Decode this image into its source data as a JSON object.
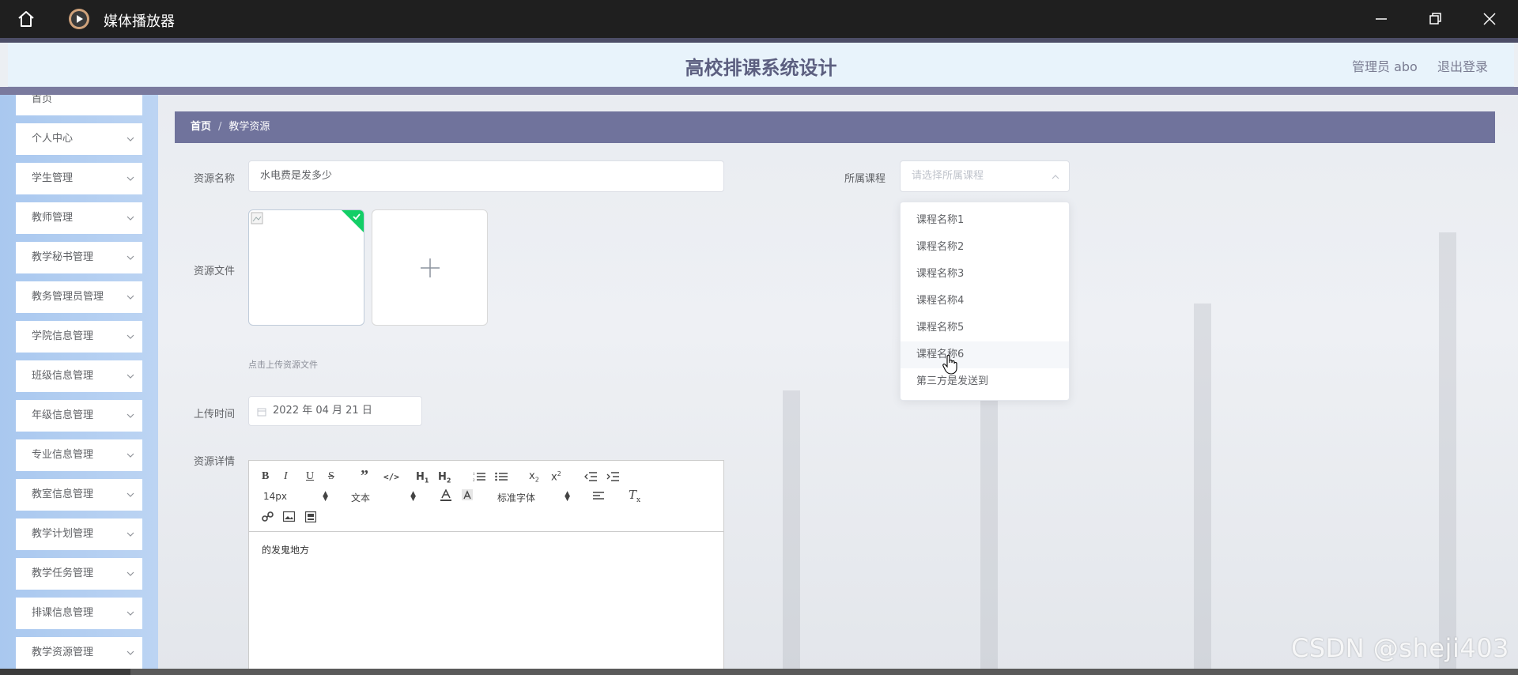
{
  "window": {
    "title": "媒体播放器"
  },
  "header": {
    "title": "高校排课系统设计",
    "user": "管理员 abo",
    "logout": "退出登录"
  },
  "sidebar": {
    "items": [
      {
        "label": "首页"
      },
      {
        "label": "个人中心"
      },
      {
        "label": "学生管理"
      },
      {
        "label": "教师管理"
      },
      {
        "label": "教学秘书管理"
      },
      {
        "label": "教务管理员管理"
      },
      {
        "label": "学院信息管理"
      },
      {
        "label": "班级信息管理"
      },
      {
        "label": "年级信息管理"
      },
      {
        "label": "专业信息管理"
      },
      {
        "label": "教室信息管理"
      },
      {
        "label": "教学计划管理"
      },
      {
        "label": "教学任务管理"
      },
      {
        "label": "排课信息管理"
      },
      {
        "label": "教学资源管理"
      }
    ]
  },
  "breadcrumb": {
    "home": "首页",
    "separator": "/",
    "current": "教学资源"
  },
  "form": {
    "name_label": "资源名称",
    "name_value": "水电费是发多少",
    "course_label": "所属课程",
    "course_placeholder": "请选择所属课程",
    "file_label": "资源文件",
    "upload_hint": "点击上传资源文件",
    "time_label": "上传时间",
    "time_value": "2022 年 04 月 21 日",
    "detail_label": "资源详情"
  },
  "editor": {
    "size_select": "14px",
    "text_select": "文本",
    "font_select": "标准字体",
    "content": "的发鬼地方"
  },
  "course_dropdown": {
    "hovered_index": 5,
    "options": [
      "课程名称1",
      "课程名称2",
      "课程名称3",
      "课程名称4",
      "课程名称5",
      "课程名称6",
      "第三方是发送到"
    ]
  },
  "watermark": "CSDN @sheji403",
  "colors": {
    "titlebar": "#1f1f1f",
    "breadcrumb": "#70739c",
    "header_bg": "#e8f3fb",
    "header_text": "#5c5f80",
    "sidebar_bg": "#a9c8ef",
    "upload_success": "#13ce66"
  }
}
